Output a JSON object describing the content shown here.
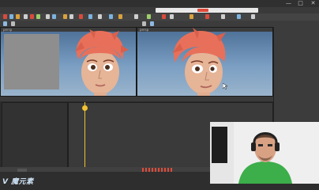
{
  "window": {
    "minimize_glyph": "—",
    "maximize_glyph": "□",
    "close_glyph": "✕"
  },
  "viewports": {
    "left_label": "persp",
    "right_label": "persp"
  },
  "watermark": {
    "text": "V 魔元素"
  },
  "colors": {
    "accent_playhead": "#f1c232",
    "viewport_sky_top": "#4a6d94",
    "viewport_sky_bottom": "#9ab4cc",
    "webcam_shirt": "#3cae4a"
  }
}
